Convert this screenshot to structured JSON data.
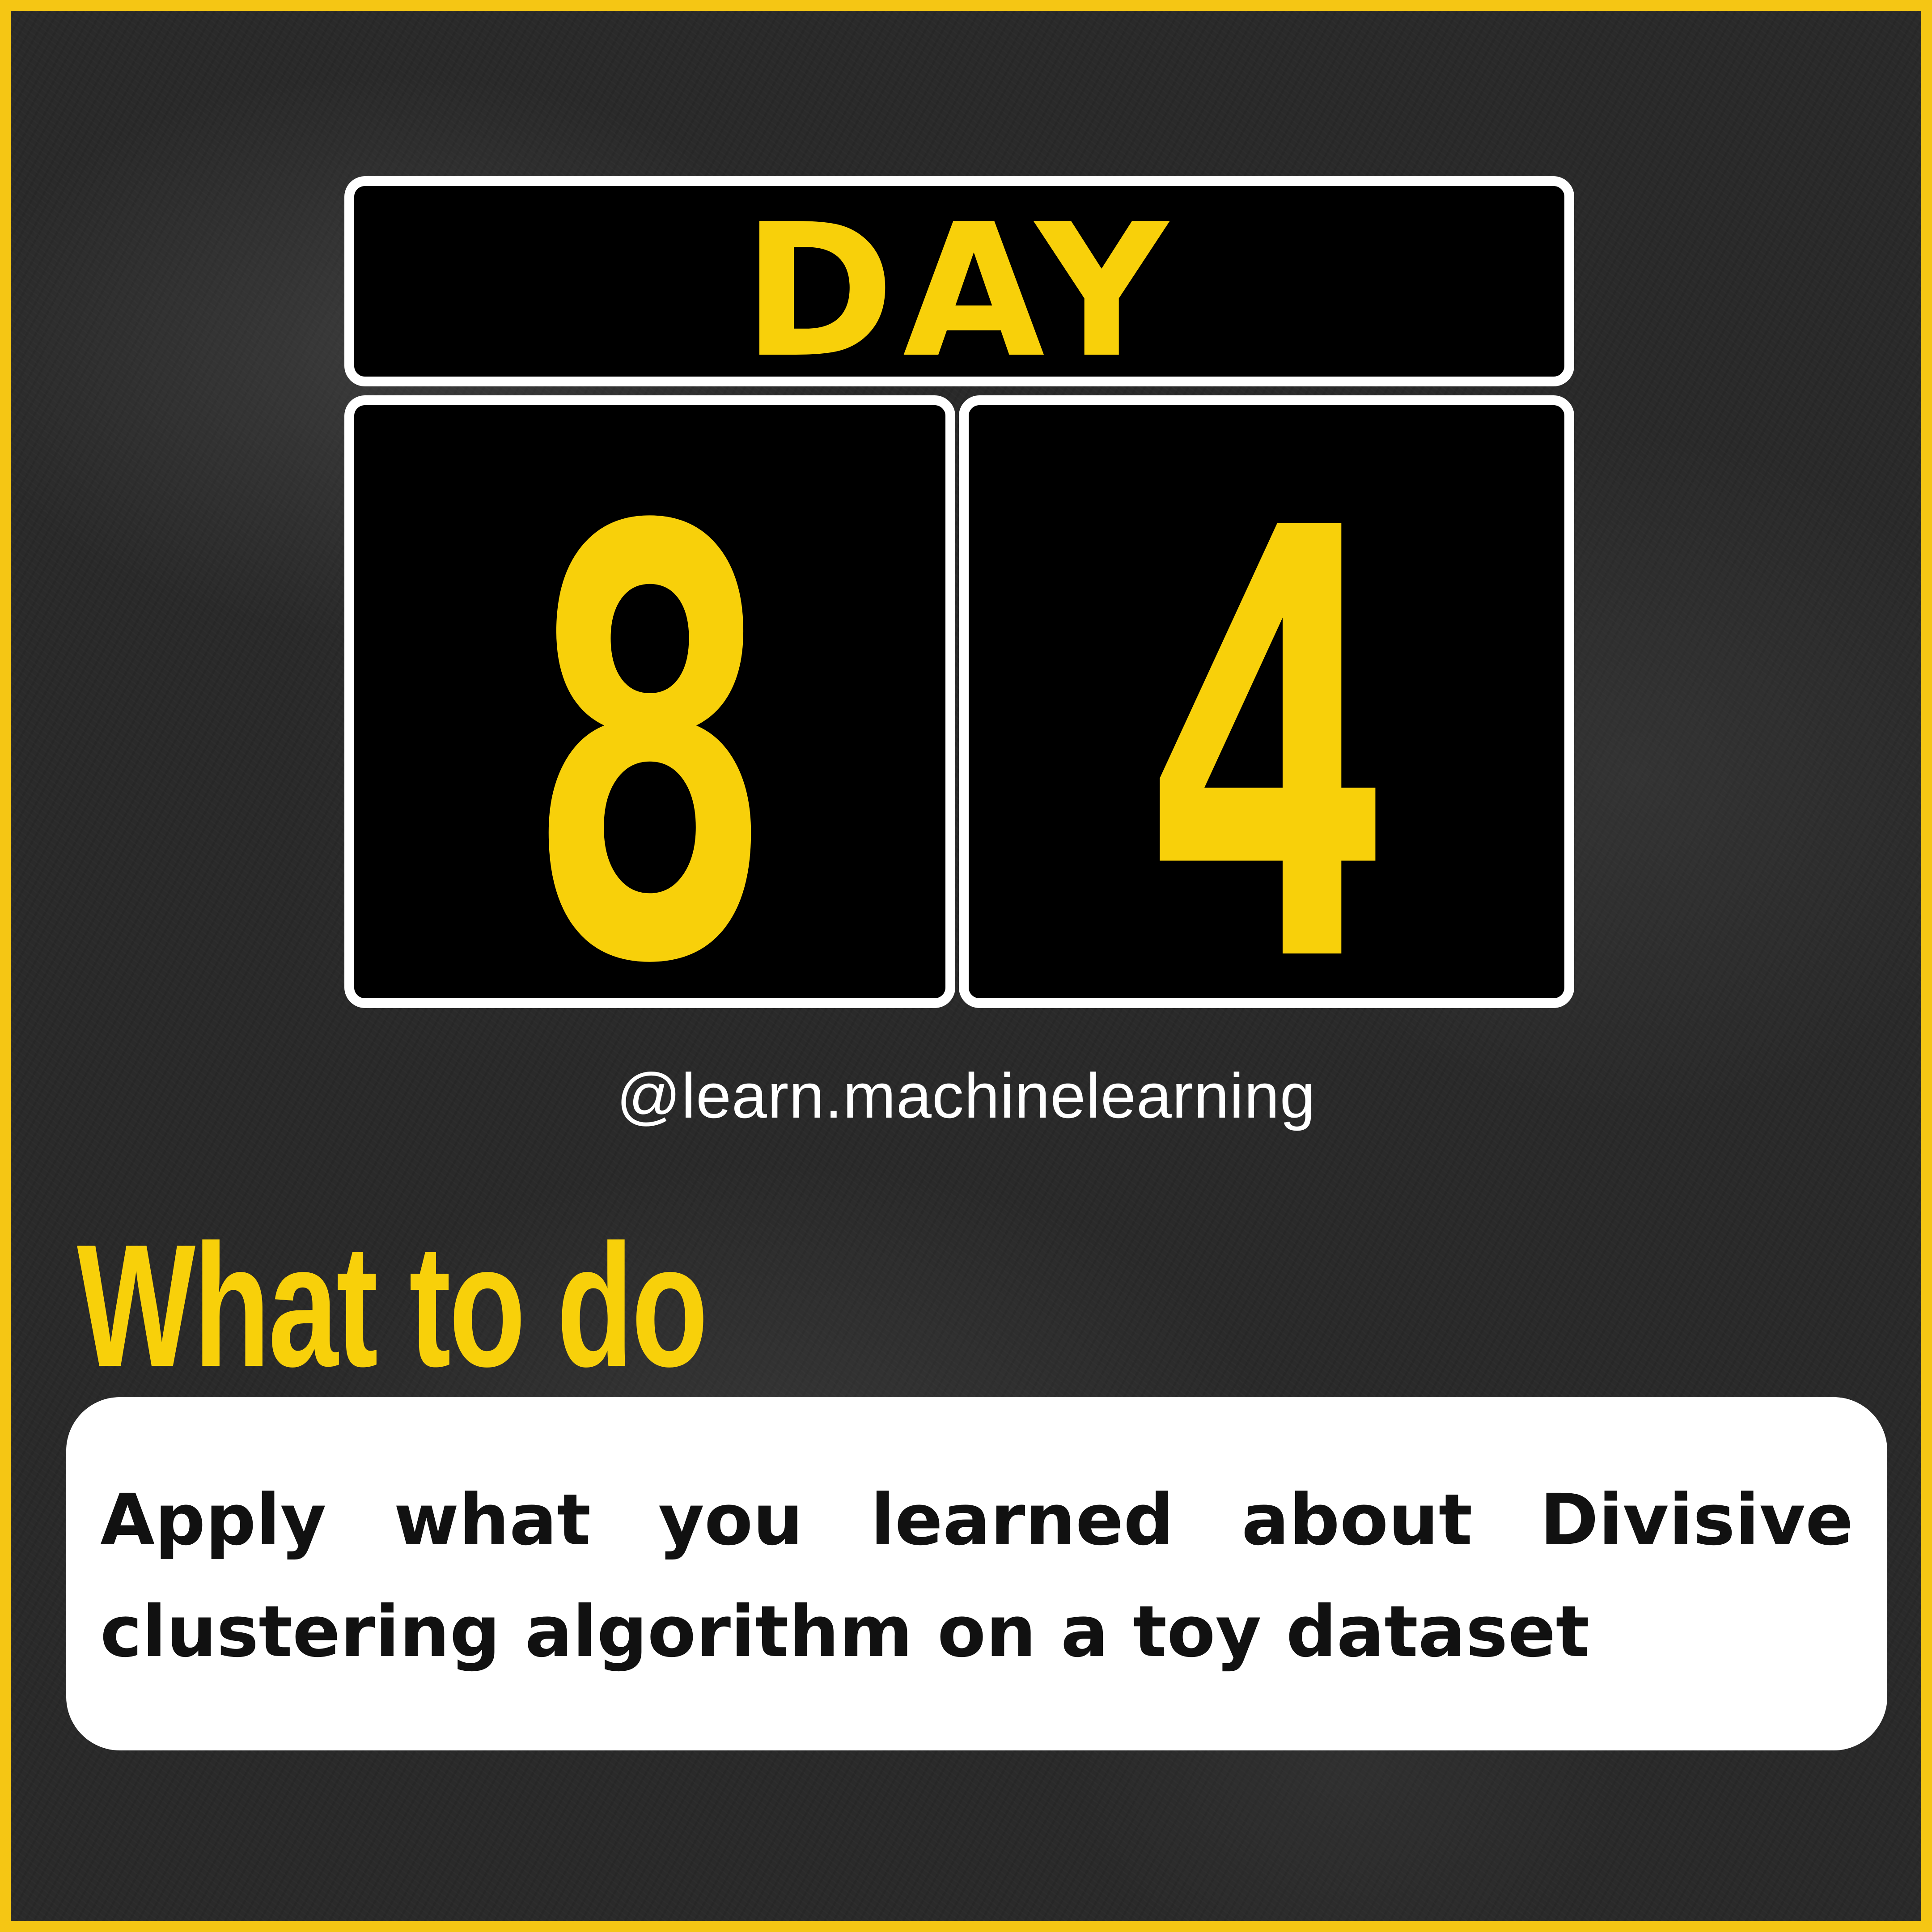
{
  "header": {
    "day_label": "DAY",
    "digits": [
      "8",
      "4"
    ]
  },
  "handle": "@learn.machinelearning",
  "section": {
    "heading": "What to do",
    "body": "Apply what you learned about Divisive clustering algorithm on a toy dataset"
  },
  "colors": {
    "accent": "#f8d00a",
    "border": "#f5c614",
    "panel": "#000000",
    "card": "#ffffff"
  }
}
